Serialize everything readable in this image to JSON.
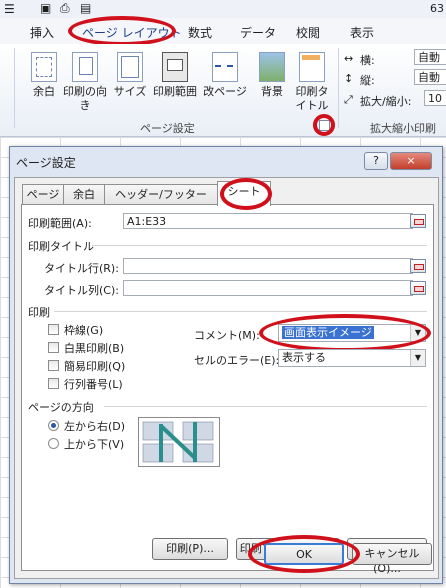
{
  "ribbon": {
    "tabs": [
      "挿入",
      "ページ レイアウト",
      "数式",
      "データ",
      "校閲",
      "表示"
    ],
    "page_number_fragment": "63",
    "buttons": [
      {
        "label": "余白",
        "icon": "margins-icon"
      },
      {
        "label": "印刷の向き",
        "icon": "orientation-icon"
      },
      {
        "label": "サイズ",
        "icon": "size-icon"
      },
      {
        "label": "印刷範囲",
        "icon": "print-area-icon"
      },
      {
        "label": "改ページ",
        "icon": "page-break-icon"
      },
      {
        "label": "背景",
        "icon": "background-icon"
      },
      {
        "label": "印刷タイトル",
        "icon": "print-titles-icon"
      }
    ],
    "group_page_setup": "ページ設定",
    "group_scale": "拡大縮小印刷",
    "scale": {
      "width_label": "横:",
      "width_value": "自動",
      "height_label": "縦:",
      "height_value": "自動",
      "zoom_label": "拡大/縮小:",
      "zoom_value": "10"
    }
  },
  "dialog": {
    "title": "ページ設定",
    "help": "?",
    "close": "×",
    "tabs": [
      "ページ",
      "余白",
      "ヘッダー/フッター",
      "シート"
    ],
    "active_tab": "シート",
    "print_area_label": "印刷範囲(A):",
    "print_area_value": "A1:E33",
    "print_titles_heading": "印刷タイトル",
    "title_rows_label": "タイトル行(R):",
    "title_cols_label": "タイトル列(C):",
    "print_heading": "印刷",
    "checks": [
      {
        "label": "枠線(G)",
        "checked": false
      },
      {
        "label": "白黒印刷(B)",
        "checked": false
      },
      {
        "label": "簡易印刷(Q)",
        "checked": false
      },
      {
        "label": "行列番号(L)",
        "checked": false
      }
    ],
    "comments_label": "コメント(M):",
    "comments_value": "画面表示イメージ",
    "errors_label": "セルのエラー(E):",
    "errors_value": "表示する",
    "order_heading": "ページの方向",
    "order_options": [
      {
        "label": "左から右(D)",
        "selected": true
      },
      {
        "label": "上から下(V)",
        "selected": false
      }
    ],
    "buttons": {
      "print": "印刷(P)...",
      "preview": "印刷プレビュー(W)",
      "options": "オプション(O)...",
      "ok": "OK",
      "cancel": "キャンセル"
    }
  },
  "colors": {
    "highlight": "#d0101a",
    "selection": "#3a72d2"
  }
}
